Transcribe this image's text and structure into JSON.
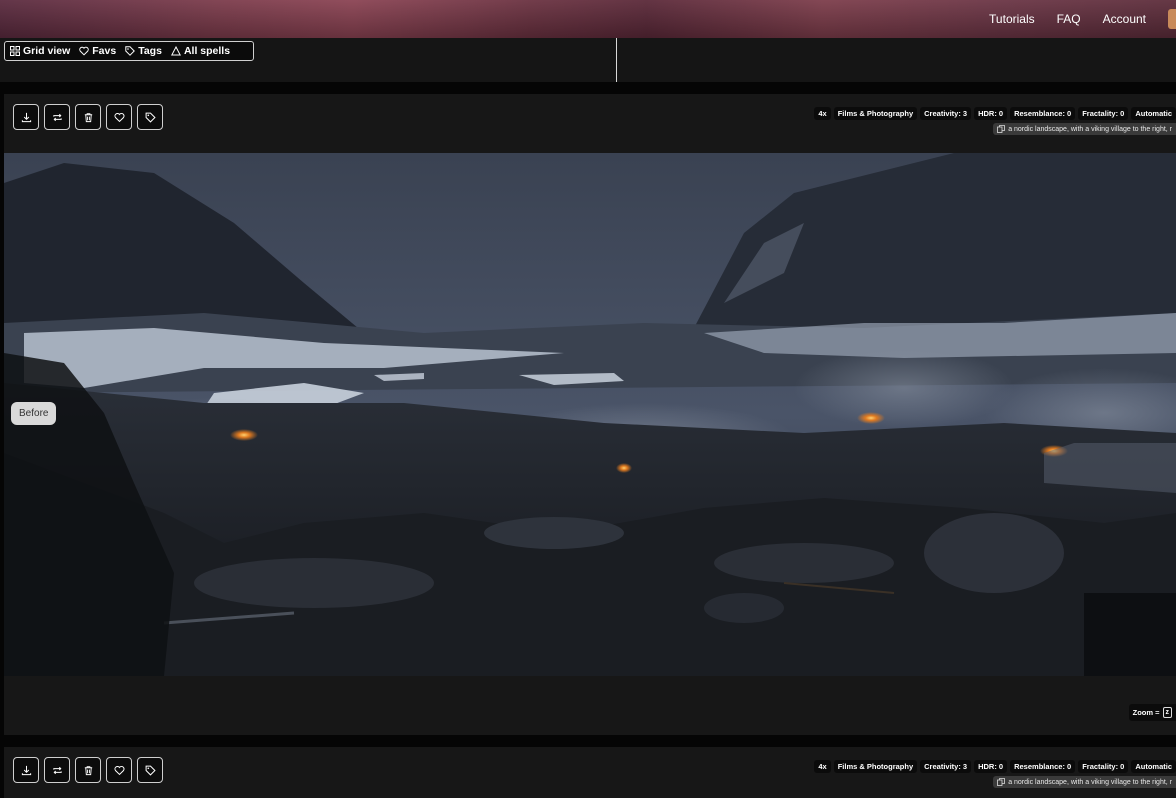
{
  "nav": {
    "tutorials": "Tutorials",
    "faq": "FAQ",
    "account": "Account"
  },
  "views": {
    "grid": "Grid view",
    "favs": "Favs",
    "tags": "Tags",
    "spells": "All spells"
  },
  "card": {
    "scale": "4x",
    "category": "Films & Photography",
    "creativity": "Creativity: 3",
    "hdr": "HDR: 0",
    "resemblance": "Resemblance: 0",
    "fractality": "Fractality: 0",
    "automation": "Automatic",
    "prompt": "a nordic landscape, with a viking village to the right, r",
    "before": "Before",
    "zoom_label": "Zoom =",
    "zoom_key": "z"
  },
  "card2": {
    "scale": "4x",
    "category": "Films & Photography",
    "creativity": "Creativity: 3",
    "hdr": "HDR: 0",
    "resemblance": "Resemblance: 0",
    "fractality": "Fractality: 0",
    "automation": "Automatic",
    "prompt": "a nordic landscape, with a viking village to the right, r"
  },
  "colors": {
    "accent": "#c88a5a",
    "card_bg": "#171717"
  }
}
